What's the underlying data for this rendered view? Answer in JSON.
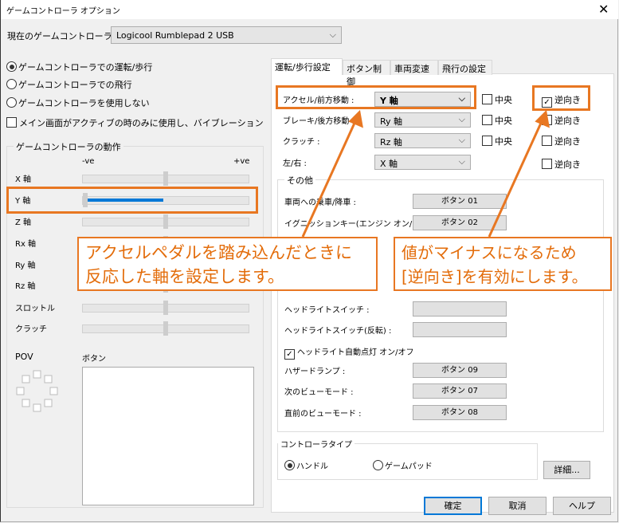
{
  "window": {
    "title": "ゲームコントローラ オプション",
    "close_icon": "close-icon"
  },
  "current_controller": {
    "label": "現在のゲームコントローラ :",
    "value": "Logicool Rumblepad 2 USB"
  },
  "modes": [
    {
      "label": "ゲームコントローラでの運転/歩行",
      "selected": true
    },
    {
      "label": "ゲームコントローラでの飛行",
      "selected": false
    },
    {
      "label": "ゲームコントローラを使用しない",
      "selected": false
    }
  ],
  "vibration_checkbox": {
    "label": "メイン画面がアクティブの時のみに使用し、バイブレーションを可能にす",
    "checked": false
  },
  "motion": {
    "title": "ゲームコントローラの動作",
    "neg": "-ve",
    "pos": "+ve",
    "axes": [
      {
        "label": "X 軸",
        "value": 0
      },
      {
        "label": "Y 軸",
        "value": -1
      },
      {
        "label": "Z 軸",
        "value": 0
      },
      {
        "label": "Rx 軸",
        "value": 0
      },
      {
        "label": "Ry 軸",
        "value": 0
      },
      {
        "label": "Rz 軸",
        "value": 0
      },
      {
        "label": "スロットル",
        "value": 0
      },
      {
        "label": "クラッチ",
        "value": 0
      }
    ],
    "pov_label": "POV",
    "buttons_label": "ボタン",
    "active_color": "#0078d7"
  },
  "tabs": [
    {
      "label": "運転/歩行設定",
      "selected": true
    },
    {
      "label": "ボタン制御"
    },
    {
      "label": "車両変速"
    },
    {
      "label": "飛行の設定"
    }
  ],
  "axis_settings": [
    {
      "label": "アクセル/前方移動 :",
      "value": "Y 軸",
      "center_label": "中央",
      "center": false,
      "reverse_label": "逆向き",
      "reverse": true
    },
    {
      "label": "ブレーキ/後方移動 :",
      "value": "Ry 軸",
      "center_label": "中央",
      "center": false,
      "reverse_label": "逆向き",
      "reverse": false
    },
    {
      "label": "クラッチ :",
      "value": "Rz 軸",
      "center_label": "中央",
      "center": false,
      "reverse_label": "逆向き",
      "reverse": false
    },
    {
      "label": "左/右 :",
      "value": "X 軸",
      "reverse_label": "逆向き",
      "reverse": false
    }
  ],
  "other": {
    "title": "その他",
    "rows_top": [
      {
        "label": "車両への乗車/降車 :",
        "button": "ボタン 01"
      },
      {
        "label": "イグニッションキー(エンジン オン/オフ):",
        "button": "ボタン 02"
      }
    ],
    "rows_mid": [
      {
        "label": "ヘッドライトスイッチ :",
        "button": ""
      },
      {
        "label": "ヘッドライトスイッチ(反転) :",
        "button": ""
      }
    ],
    "auto_headlight": {
      "label": "ヘッドライト自動点灯 オン/オフ",
      "checked": true
    },
    "rows_bottom": [
      {
        "label": "ハザードランプ :",
        "button": "ボタン 09"
      },
      {
        "label": "次のビューモード :",
        "button": "ボタン 07"
      },
      {
        "label": "直前のビューモード :",
        "button": "ボタン 08"
      }
    ]
  },
  "controller_type": {
    "title": "コントローラタイプ",
    "options": [
      {
        "label": "ハンドル",
        "selected": true
      },
      {
        "label": "ゲームパッド",
        "selected": false
      }
    ]
  },
  "details_button": "詳細...",
  "footer": {
    "ok": "確定",
    "cancel": "取消",
    "help": "ヘルプ"
  },
  "callouts": {
    "left": [
      "アクセルペダルを踏み込んだときに",
      "反応した軸を設定します。"
    ],
    "right": [
      "値がマイナスになるため",
      "[逆向き]を有効にします。"
    ],
    "color": "#e87722"
  }
}
